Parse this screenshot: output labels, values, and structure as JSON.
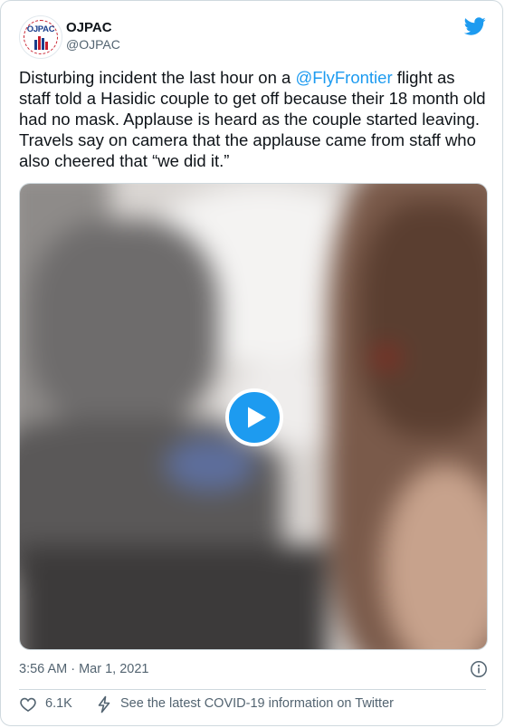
{
  "author": {
    "display_name": "OJPAC",
    "handle": "@OJPAC",
    "avatar_text": "OJPAC"
  },
  "tweet": {
    "text_before": "Disturbing incident the last hour on a ",
    "mention": "@FlyFrontier",
    "text_after": " flight as staff told a Hasidic couple to get off because their 18 month old had no mask. Applause is heard as the couple started leaving. Travels say on camera that the applause came from staff who also cheered that “we did it.”"
  },
  "media": {
    "type": "video",
    "play_icon": "play-icon"
  },
  "meta": {
    "timestamp": "3:56 AM · Mar 1, 2021",
    "info_icon": "info-icon"
  },
  "actions": {
    "like_count": "6.1K",
    "like_icon": "heart-icon",
    "covid_text": "See the latest COVID-19 information on Twitter",
    "covid_icon": "lightning-icon"
  },
  "colors": {
    "accent": "#1d9bf0",
    "text": "#0f1419",
    "secondary": "#536471",
    "border": "#cfd9de"
  }
}
